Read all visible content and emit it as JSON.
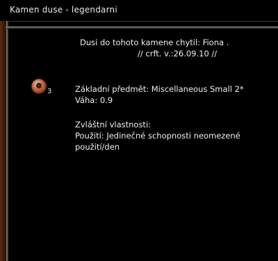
{
  "window": {
    "title": "Kamen duse - legendarni"
  },
  "header": {
    "caught_line": "Dusi do tohoto kamene chytil: Fiona .",
    "crafted_line": "// crft. v.:26.09.10 //"
  },
  "item": {
    "icon": "soul-stone-icon",
    "count": "3"
  },
  "details": {
    "base_item": "Základní předmět: Miscellaneous Small 2*",
    "weight": "Váha:  0.9",
    "special_heading": "Zvláštní vlastnosti:",
    "use_line_1": "Použití: Jedinečné schopnosti neomezené",
    "use_line_2": "použití/den"
  },
  "colors": {
    "background": "#000000",
    "text": "#f0f0f0",
    "frame_accent": "#5a2b14"
  }
}
